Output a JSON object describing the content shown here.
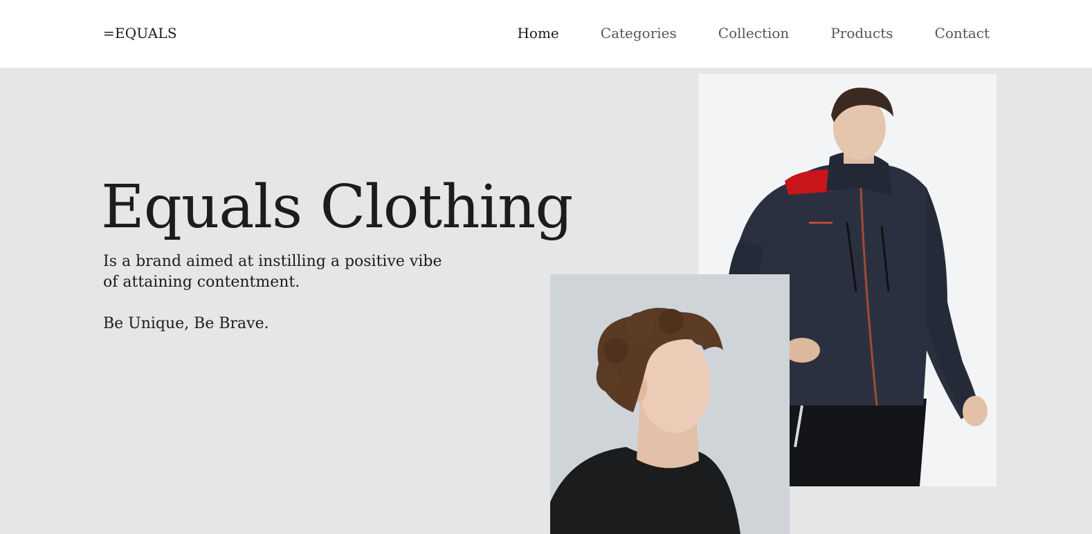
{
  "header": {
    "logo": "=EQUALS",
    "nav": [
      {
        "label": "Home",
        "active": true
      },
      {
        "label": "Categories",
        "active": false
      },
      {
        "label": "Collection",
        "active": false
      },
      {
        "label": "Products",
        "active": false
      },
      {
        "label": "Contact",
        "active": false
      }
    ]
  },
  "hero": {
    "title": "Equals Clothing",
    "description": "Is a brand aimed at instilling a positive vibe of attaining contentment.",
    "slogan": "Be Unique, Be Brave."
  },
  "colors": {
    "background": "#e6e6e7",
    "header_bg": "#ffffff",
    "text": "#1c1c1c",
    "nav_inactive": "#555555"
  }
}
